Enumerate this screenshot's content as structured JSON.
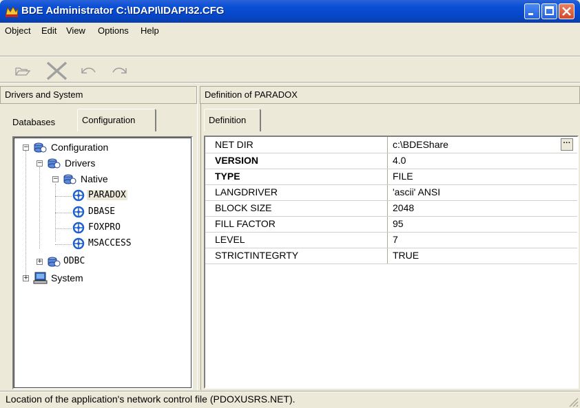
{
  "window": {
    "title": "BDE Administrator  C:\\IDAPI\\IDAPI32.CFG"
  },
  "menu": {
    "items": [
      "Object",
      "Edit",
      "View",
      "Options",
      "Help"
    ]
  },
  "toolbar": {
    "icons": [
      "open-folder-icon",
      "delete-x-icon",
      "undo-icon",
      "redo-icon"
    ]
  },
  "left_pane": {
    "header": "Drivers and System",
    "tabs": [
      "Databases",
      "Configuration"
    ],
    "active_tab": "Configuration",
    "tree": {
      "root": "Configuration",
      "drivers": "Drivers",
      "native": "Native",
      "paradox": "PARADOX",
      "dbase": "DBASE",
      "foxpro": "FOXPRO",
      "msaccess": "MSACCESS",
      "odbc": "ODBC",
      "system": "System"
    }
  },
  "right_pane": {
    "header": "Definition of PARADOX",
    "tabs": [
      "Definition"
    ],
    "properties": [
      {
        "name": "NET DIR",
        "value": "c:\\BDEShare",
        "bold": false
      },
      {
        "name": "VERSION",
        "value": "4.0",
        "bold": true
      },
      {
        "name": "TYPE",
        "value": "FILE",
        "bold": true
      },
      {
        "name": "LANGDRIVER",
        "value": "'ascii' ANSI",
        "bold": false
      },
      {
        "name": "BLOCK SIZE",
        "value": "2048",
        "bold": false
      },
      {
        "name": "FILL FACTOR",
        "value": "95",
        "bold": false
      },
      {
        "name": "LEVEL",
        "value": "7",
        "bold": false
      },
      {
        "name": "STRICTINTEGRTY",
        "value": "TRUE",
        "bold": false
      }
    ],
    "ellipsis_label": "···"
  },
  "status_bar": {
    "text": "Location of the application's network control file (PDOXUSRS.NET)."
  }
}
